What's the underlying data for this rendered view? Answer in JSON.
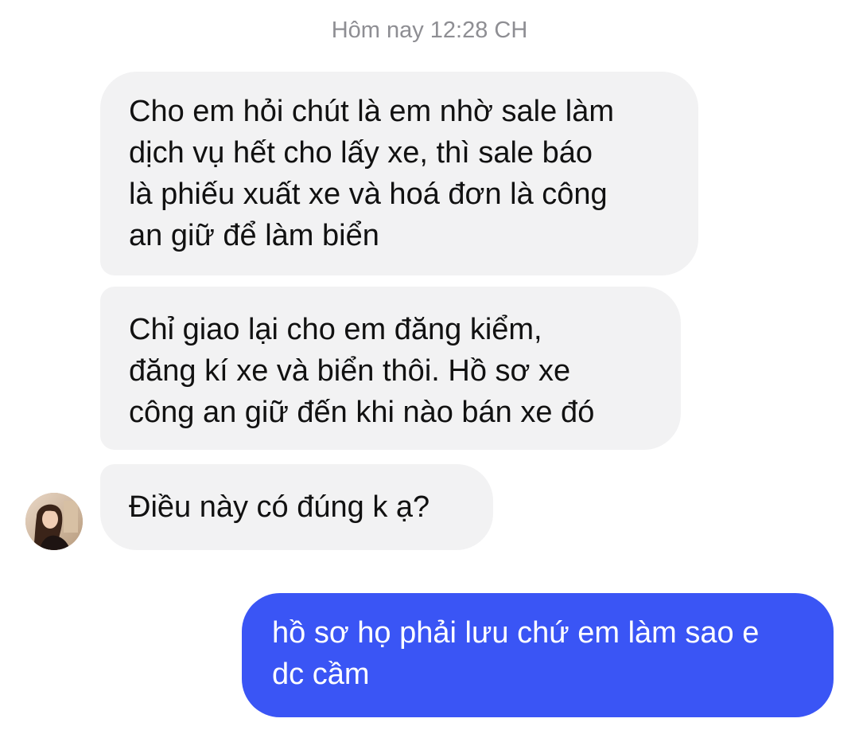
{
  "header": {
    "timestamp": "Hôm nay 12:28 CH"
  },
  "conversation": {
    "messages": [
      {
        "direction": "incoming",
        "text": "Cho em hỏi chút là em nhờ sale làm\ndịch vụ hết cho lấy xe, thì sale báo\nlà phiếu xuất xe và hoá đơn là công\nan giữ để làm biển"
      },
      {
        "direction": "incoming",
        "text": "Chỉ giao lại cho em đăng kiểm,\nđăng kí xe và biển thôi. Hồ sơ xe\ncông an giữ đến khi nào bán xe đó"
      },
      {
        "direction": "incoming",
        "text": "Điều này có đúng k ạ?"
      },
      {
        "direction": "outgoing",
        "text": "hồ sơ họ phải lưu chứ em làm sao e\ndc cầm"
      }
    ]
  },
  "colors": {
    "incoming_bubble": "#f2f2f3",
    "outgoing_bubble": "#3a55f5",
    "timestamp_text": "#8e8e93"
  },
  "sender": {
    "avatar_icon": "profile-photo"
  }
}
